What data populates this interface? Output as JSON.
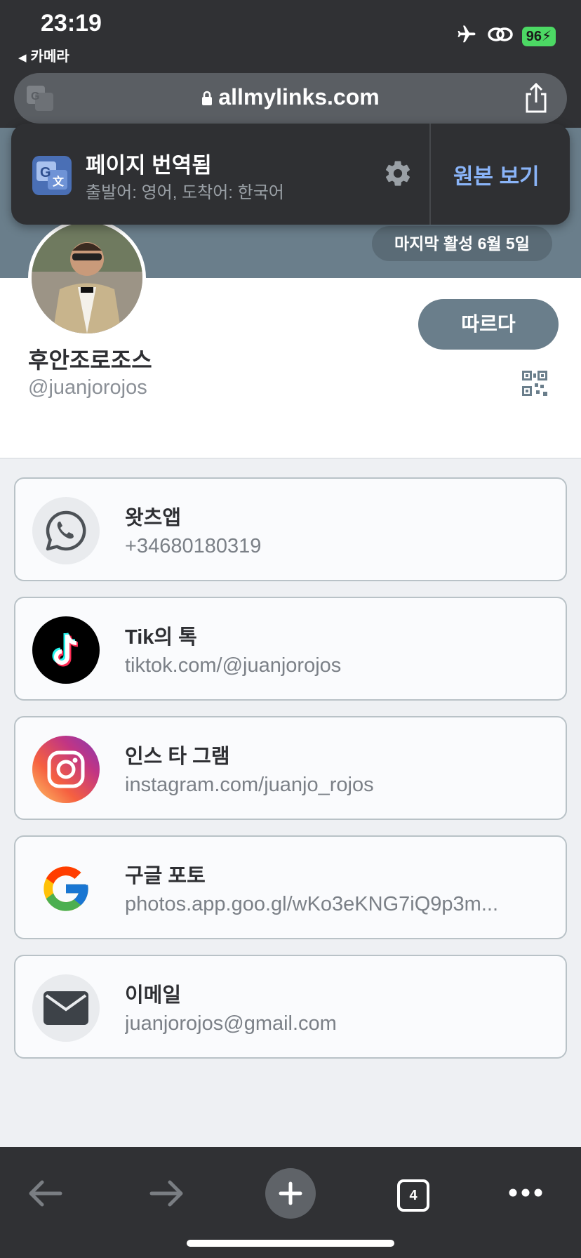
{
  "status_bar": {
    "time": "23:19",
    "back_app": "카메라",
    "battery": "96"
  },
  "url_bar": {
    "domain": "allmylinks.com"
  },
  "translate_popup": {
    "title": "페이지 번역됨",
    "subtitle": "출발어: 영어, 도착어: 한국어",
    "show_original": "원본 보기"
  },
  "profile": {
    "last_active": "마지막 활성 6월 5일",
    "name": "후안조로조스",
    "handle": "@juanjorojos",
    "follow_label": "따르다"
  },
  "links": [
    {
      "title": "왓츠앱",
      "url": "+34680180319",
      "icon": "whatsapp-icon"
    },
    {
      "title": "Tik의 톡",
      "url": "tiktok.com/@juanjorojos",
      "icon": "tiktok-icon"
    },
    {
      "title": "인스 타 그램",
      "url": "instagram.com/juanjo_rojos",
      "icon": "instagram-icon"
    },
    {
      "title": "구글 포토",
      "url": "photos.app.goo.gl/wKo3eKNG7iQ9p3m...",
      "icon": "google-icon"
    },
    {
      "title": "이메일",
      "url": "juanjorojos@gmail.com",
      "icon": "mail-icon"
    }
  ],
  "toolbar": {
    "tab_count": "4"
  },
  "colors": {
    "chrome": "#303134",
    "banner": "#6a7e8b",
    "link_blue": "#8ab4f8",
    "card_border": "#b9c2c7"
  }
}
